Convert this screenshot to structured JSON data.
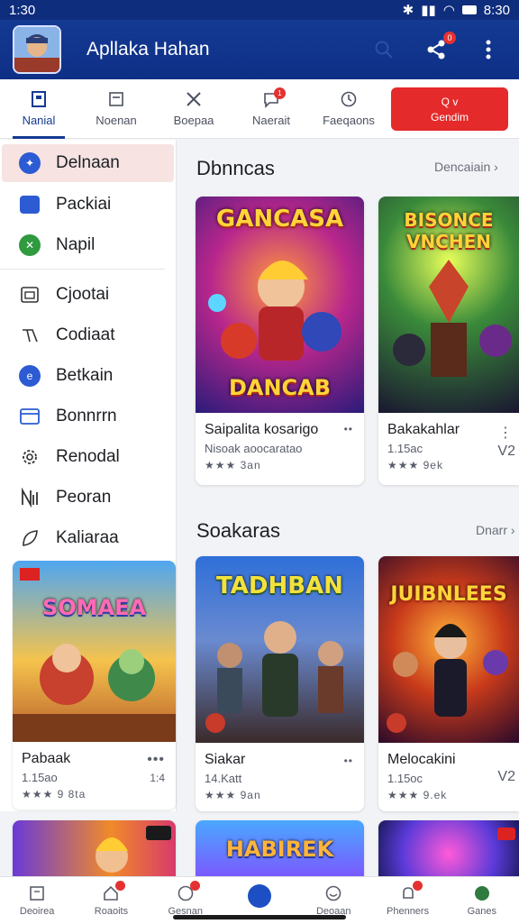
{
  "status": {
    "time_left": "1:30",
    "time_right": "8:30"
  },
  "appbar": {
    "title": "Apllaka Hahan",
    "notification_count": "0"
  },
  "top_tabs": [
    {
      "label": "Nanial"
    },
    {
      "label": "Noenan"
    },
    {
      "label": "Boepaa"
    },
    {
      "label": "Naerait",
      "badge": "1"
    },
    {
      "label": "Faeqaons"
    }
  ],
  "cta": {
    "line1": "Q v",
    "line2": "Gendim"
  },
  "sidebar": {
    "items": [
      {
        "label": "Delnaan"
      },
      {
        "label": "Packiai"
      },
      {
        "label": "Napil"
      },
      {
        "label": "Cjootai"
      },
      {
        "label": "Codiaat"
      },
      {
        "label": "Betkain"
      },
      {
        "label": "Bonnrrn"
      },
      {
        "label": "Renodal"
      },
      {
        "label": "Peoran"
      },
      {
        "label": "Kaliaraa"
      }
    ]
  },
  "sections": [
    {
      "title": "Dbnncas",
      "link": "Dencaiain"
    },
    {
      "title": "Soakaras",
      "link": "Dnarr"
    }
  ],
  "cards": [
    {
      "art_title": "GANCASA",
      "art_sub": "DANCAB",
      "title": "Saipalita kosarigo",
      "sub": "Nisoak aoocaratao",
      "rating": "★★★ 3an"
    },
    {
      "art_title": "BISONCE",
      "art_sub": "VNCHEN",
      "title": "Bakakahlar",
      "sub": "1.15ac",
      "rating": "★★★ 9ek",
      "extra": "V2"
    },
    {
      "art_title": "SOMAEA",
      "art_sub": "",
      "title": "Pabaak",
      "sub": "1.15ao",
      "rating": "★★★ 9 8ta",
      "extra": "1:4"
    },
    {
      "art_title": "TADHBAN",
      "art_sub": "",
      "title": "Siakar",
      "sub": "14.Katt",
      "rating": "★★★ 9an"
    },
    {
      "art_title": "JUIBNLEES",
      "art_sub": "",
      "title": "Melocakini",
      "sub": "1.15oc",
      "rating": "★★★ 9.ek",
      "extra": "V2"
    },
    {
      "art_title": "",
      "art_sub": "",
      "title": "",
      "sub": "",
      "rating": ""
    },
    {
      "art_title": "HABIREK",
      "art_sub": "",
      "title": "",
      "sub": "",
      "rating": ""
    },
    {
      "art_title": "",
      "art_sub": "",
      "title": "",
      "sub": "",
      "rating": ""
    }
  ],
  "bottom_nav": [
    {
      "label": "Deoirea"
    },
    {
      "label": "Roaoits",
      "badge": true
    },
    {
      "label": "Gesnan",
      "badge": true
    },
    {
      "label": ""
    },
    {
      "label": "Deoaan"
    },
    {
      "label": "Phenners",
      "badge": true
    },
    {
      "label": "Ganes"
    }
  ],
  "colors": {
    "primary": "#143a93",
    "accent": "#e42a2a",
    "active_row": "#f6e3e2"
  }
}
